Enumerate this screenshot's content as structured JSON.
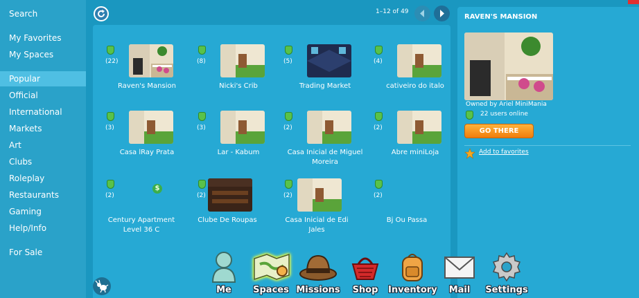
{
  "sidebar": {
    "items": [
      {
        "label": "Search"
      },
      {
        "label": "My Favorites"
      },
      {
        "label": "My Spaces"
      },
      {
        "label": "Popular",
        "active": true
      },
      {
        "label": "Official"
      },
      {
        "label": "International"
      },
      {
        "label": "Markets"
      },
      {
        "label": "Art"
      },
      {
        "label": "Clubs"
      },
      {
        "label": "Roleplay"
      },
      {
        "label": "Restaurants"
      },
      {
        "label": "Gaming"
      },
      {
        "label": "Help/Info"
      },
      {
        "label": "For Sale"
      }
    ]
  },
  "main": {
    "pager": "1–12 of 49",
    "tiles": [
      {
        "name": "Raven's Mansion",
        "count": "(22)",
        "thumb": "mansion"
      },
      {
        "name": "Nicki's Crib",
        "count": "(8)",
        "thumb": "room"
      },
      {
        "name": "Trading Market",
        "count": "(5)",
        "thumb": "market"
      },
      {
        "name": "cativeiro do italo",
        "count": "(4)",
        "thumb": "room"
      },
      {
        "name": "Casa lRay Prata",
        "count": "(3)",
        "thumb": "room"
      },
      {
        "name": "Lar - Kabum",
        "count": "(3)",
        "thumb": "room"
      },
      {
        "name": "Casa Inicial de Miguel Moreira",
        "count": "(2)",
        "thumb": "room"
      },
      {
        "name": "Abre miniLoja",
        "count": "(2)",
        "thumb": "room"
      },
      {
        "name": "Century Apartment Level 36 C",
        "count": "(2)",
        "thumb": "none",
        "for_sale": true
      },
      {
        "name": "Clube De Roupas",
        "count": "(2)",
        "thumb": "club"
      },
      {
        "name": "Casa Inicial de Edi Jales",
        "count": "(2)",
        "thumb": "room"
      },
      {
        "name": "Bj Ou Passa",
        "count": "(2)",
        "thumb": "none"
      }
    ]
  },
  "detail": {
    "title": "RAVEN'S MANSION",
    "owner": "Owned by Ariel MiniMania",
    "online": "22 users online",
    "go_button": "GO THERE",
    "favorite_link": "Add to favorites"
  },
  "dock": [
    {
      "label": "Me",
      "icon": "avatar-icon"
    },
    {
      "label": "Spaces",
      "icon": "map-icon",
      "active": true
    },
    {
      "label": "Missions",
      "icon": "hat-icon"
    },
    {
      "label": "Shop",
      "icon": "basket-icon"
    },
    {
      "label": "Inventory",
      "icon": "backpack-icon"
    },
    {
      "label": "Mail",
      "icon": "envelope-icon"
    },
    {
      "label": "Settings",
      "icon": "gear-icon"
    }
  ]
}
